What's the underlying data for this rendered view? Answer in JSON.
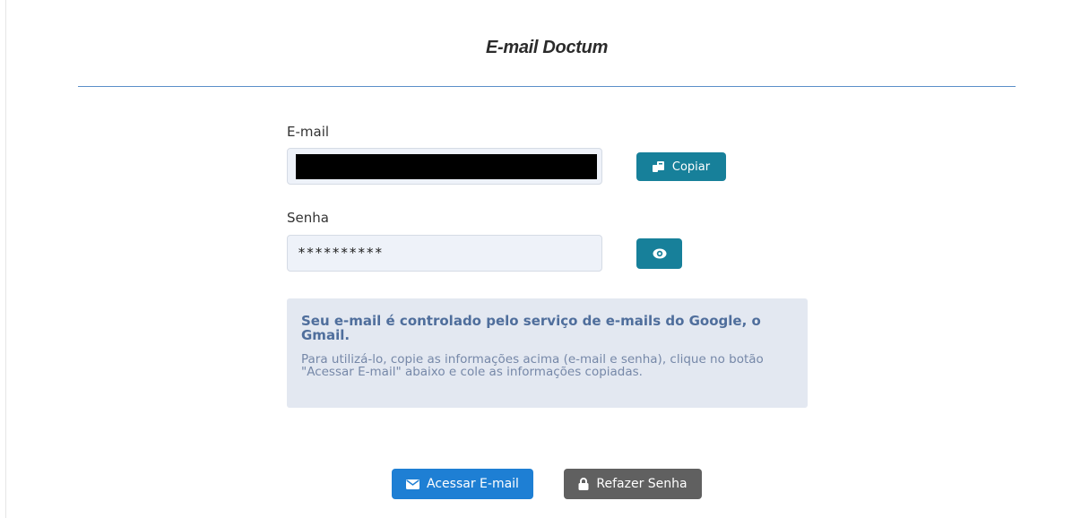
{
  "page": {
    "title": "E-mail Doctum"
  },
  "email": {
    "label": "E-mail",
    "value": "",
    "copy_button": {
      "label": "Copiar",
      "icon": "copy-icon"
    }
  },
  "password": {
    "label": "Senha",
    "masked_value": "**********",
    "toggle_button": {
      "icon": "eye-icon"
    }
  },
  "info": {
    "title": "Seu e-mail é controlado pelo serviço de e-mails do Google, o Gmail.",
    "text": "Para utilizá-lo, copie as informações acima (e-mail e senha), clique no botão \"Acessar E-mail\" abaixo e cole as informações copiadas."
  },
  "actions": {
    "access": {
      "label": "Acessar E-mail",
      "icon": "envelope-icon"
    },
    "reset": {
      "label": "Refazer Senha",
      "icon": "lock-icon"
    }
  },
  "colors": {
    "teal_button": "#17809a",
    "blue_button": "#1e7fd4",
    "gray_button": "#606060",
    "divider": "#5b8fc9",
    "info_bg": "#e3e8f1",
    "info_title": "#4f6e9c"
  }
}
